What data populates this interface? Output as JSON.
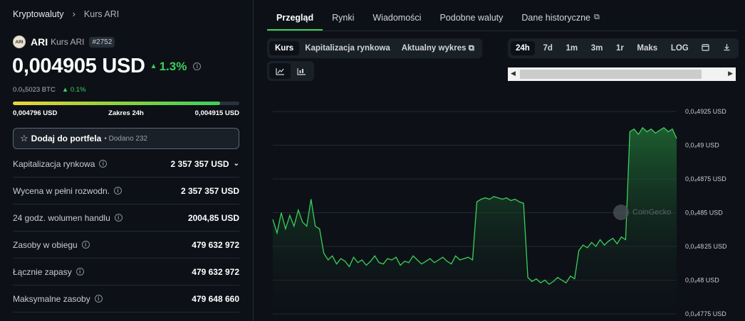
{
  "breadcrumb": {
    "root": "Kryptowaluty",
    "current": "Kurs ARI"
  },
  "coin": {
    "logo_text": "ARI",
    "symbol": "ARI",
    "name": "Kurs ARI",
    "rank": "#2752"
  },
  "price": {
    "value": "0,004905 USD",
    "change": "1.3%",
    "btc_value": "0.0₅5023 BTC",
    "btc_change": "0.1%"
  },
  "range": {
    "low": "0,004796 USD",
    "label": "Zakres 24h",
    "high": "0,004915 USD",
    "fill_fraction": 0.915
  },
  "portfolio": {
    "label": "Dodaj do portfela",
    "added": "• Dodano 232"
  },
  "stats": [
    {
      "label": "Kapitalizacja rynkowa",
      "value": "2 357 357 USD"
    },
    {
      "label": "Wycena w pełni rozwodn.",
      "value": "2 357 357 USD"
    },
    {
      "label": "24 godz. wolumen handlu",
      "value": "2004,85 USD"
    },
    {
      "label": "Zasoby w obiegu",
      "value": "479 632 972"
    },
    {
      "label": "Łącznie zapasy",
      "value": "479 632 972"
    },
    {
      "label": "Maksymalne zasoby",
      "value": "479 648 660"
    }
  ],
  "tabs": [
    "Przegląd",
    "Rynki",
    "Wiadomości",
    "Podobne waluty",
    "Dane historyczne"
  ],
  "chart_tabs": [
    "Kurs",
    "Kapitalizacja rynkowa",
    "Aktualny wykres"
  ],
  "ranges": [
    "24h",
    "7d",
    "1m",
    "3m",
    "1r",
    "Maks",
    "LOG"
  ],
  "watermark": "CoinGecko",
  "colors": {
    "accent": "#3ccf5a",
    "background": "#0d1117",
    "panel": "#1a2028"
  },
  "chart_data": {
    "type": "area",
    "y_ticks": [
      "0,0₄4925 USD",
      "0,0₄49 USD",
      "0,0₄4875 USD",
      "0,0₄485 USD",
      "0,0₄48 25 USD",
      "0,0₄48 USD",
      "0,0₄4775 USD"
    ],
    "y_tick_values": [
      0.004925,
      0.0049,
      0.004875,
      0.00485,
      0.004825,
      0.0048,
      0.004775
    ],
    "ylim": [
      0.004775,
      0.004925
    ],
    "grid": true,
    "series": [
      {
        "values": [
          0.004845,
          0.004835,
          0.00485,
          0.004838,
          0.004848,
          0.00484,
          0.004852,
          0.004843,
          0.00484,
          0.00486,
          0.00484,
          0.004838,
          0.00482,
          0.004815,
          0.004818,
          0.004812,
          0.004816,
          0.004814,
          0.00481,
          0.004817,
          0.004813,
          0.004815,
          0.004811,
          0.004814,
          0.004818,
          0.004813,
          0.004812,
          0.004816,
          0.004815,
          0.004817,
          0.004811,
          0.004814,
          0.004813,
          0.004818,
          0.004815,
          0.004812,
          0.004814,
          0.004816,
          0.004813,
          0.004815,
          0.004817,
          0.004814,
          0.004812,
          0.004818,
          0.004815,
          0.004816,
          0.004817,
          0.004815,
          0.004858,
          0.00486,
          0.004861,
          0.00486,
          0.004862,
          0.004861,
          0.00486,
          0.004861,
          0.004859,
          0.00486,
          0.004858,
          0.004857,
          0.004802,
          0.004799,
          0.004801,
          0.004798,
          0.0048,
          0.004797,
          0.004799,
          0.004802,
          0.0048,
          0.004798,
          0.004803,
          0.004801,
          0.004822,
          0.004826,
          0.004824,
          0.004828,
          0.004825,
          0.00483,
          0.004826,
          0.004829,
          0.004831,
          0.004827,
          0.004832,
          0.00483,
          0.00491,
          0.004912,
          0.004908,
          0.004913,
          0.00491,
          0.004912,
          0.004909,
          0.004911,
          0.004913,
          0.00491,
          0.004912,
          0.004905
        ]
      }
    ]
  }
}
